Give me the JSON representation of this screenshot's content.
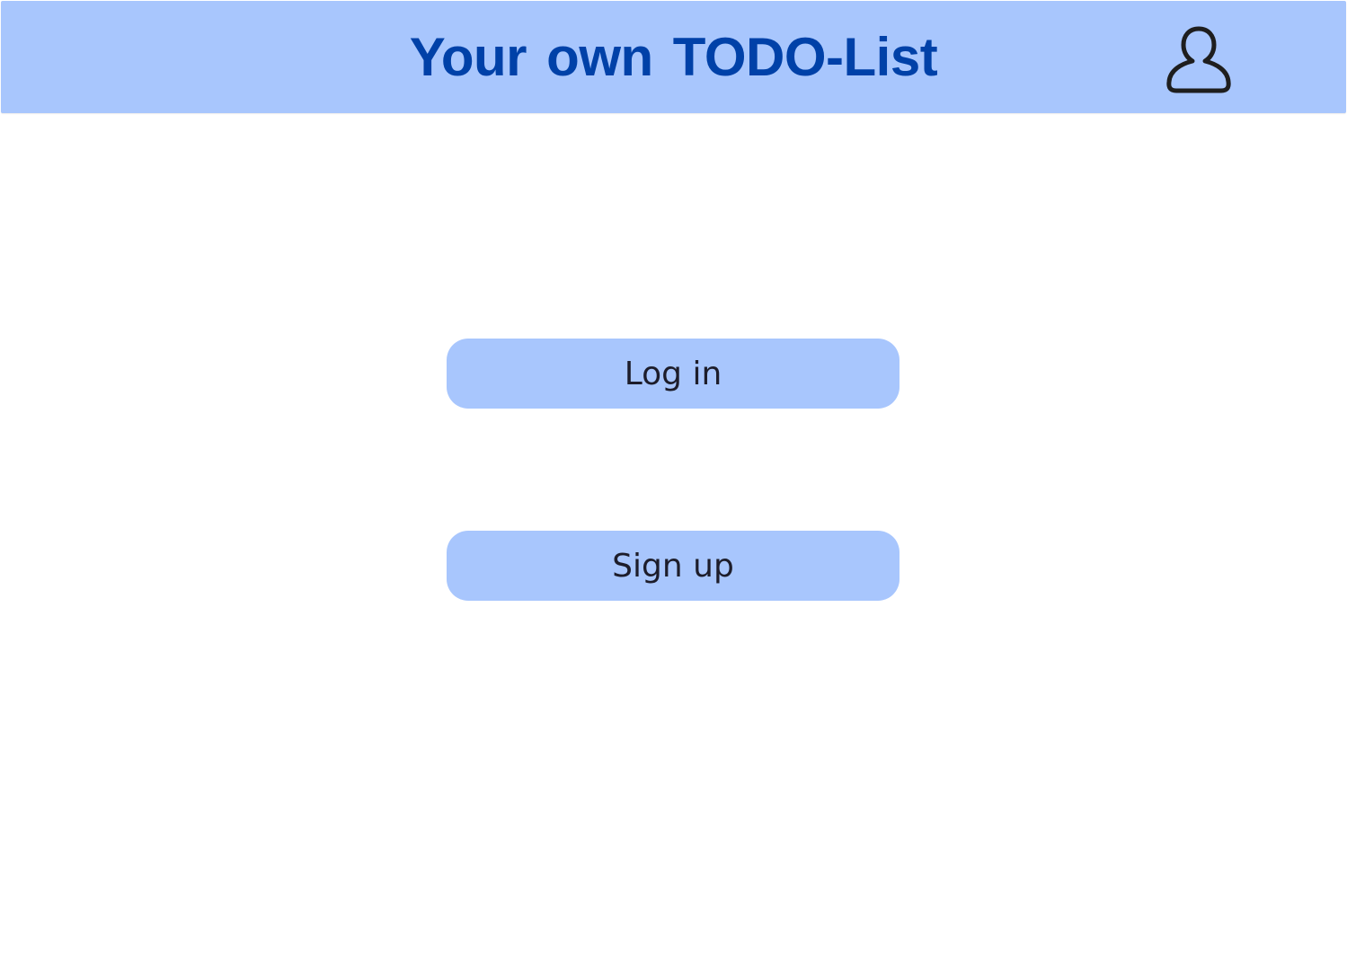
{
  "header": {
    "title": "Your own  TODO-List",
    "user_icon": "user-icon"
  },
  "actions": {
    "login_label": "Log in",
    "signup_label": "Sign up"
  },
  "colors": {
    "header_bg": "#a8c6fd",
    "title_color": "#0041a8",
    "button_bg": "#a8c6fd",
    "button_text": "#1d1d2b",
    "icon_stroke": "#1e1e1e"
  }
}
